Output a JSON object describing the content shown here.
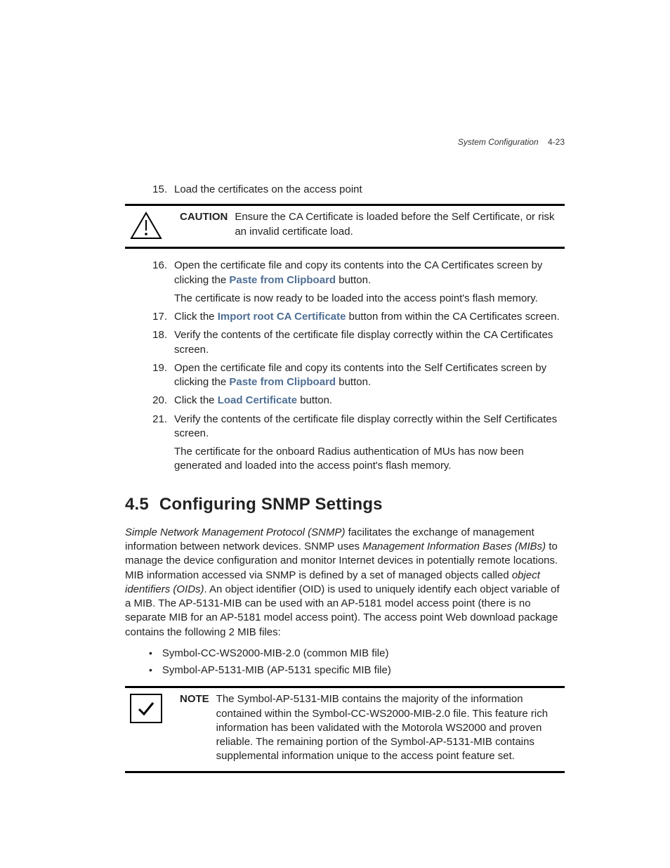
{
  "header": {
    "chapter": "System Configuration",
    "page": "4-23"
  },
  "steps_first": [
    {
      "n": "15.",
      "paras": [
        "Load the certificates on the access point"
      ]
    }
  ],
  "caution": {
    "label": "CAUTION",
    "text": "Ensure the CA Certificate is loaded before the Self Certificate, or risk an invalid certificate load."
  },
  "steps_after": [
    {
      "n": "16.",
      "paras": [
        "Open the certificate file and copy its contents into the CA Certificates screen by clicking the {link:Paste from Clipboard} button.",
        "The certificate is now ready to be loaded into the access point's flash memory."
      ]
    },
    {
      "n": "17.",
      "paras": [
        "Click the {link:Import root CA Certificate} button from within the CA Certificates screen."
      ]
    },
    {
      "n": "18.",
      "paras": [
        "Verify the contents of the certificate file display correctly within the CA Certificates screen."
      ]
    },
    {
      "n": "19.",
      "paras": [
        "Open the certificate file and copy its contents into the Self Certificates screen by clicking the {link:Paste from Clipboard} button."
      ]
    },
    {
      "n": "20.",
      "paras": [
        "Click the {link:Load Certificate} button."
      ]
    },
    {
      "n": "21.",
      "paras": [
        "Verify the contents of the certificate file display correctly within the Self Certificates screen.",
        "The certificate for the onboard Radius authentication of MUs has now been generated and loaded into the access point's flash memory."
      ]
    }
  ],
  "section": {
    "num": "4.5",
    "title": "Configuring SNMP Settings"
  },
  "intro_spans": [
    {
      "t": "Simple Network Management Protocol (SNMP)",
      "i": true
    },
    {
      "t": " facilitates the exchange of management information between network devices. SNMP uses "
    },
    {
      "t": "Management Information Bases (MIBs)",
      "i": true
    },
    {
      "t": " to manage the device configuration and monitor Internet devices in potentially remote locations. MIB information accessed via SNMP is defined by a set of managed objects called "
    },
    {
      "t": "object identifiers (OIDs)",
      "i": true
    },
    {
      "t": ". An object identifier (OID) is used to uniquely identify each object variable of a MIB. The AP-5131-MIB can be used with an AP-5181 model access point (there is no separate MIB for an AP-5181 model access point). The access point Web download package contains the following 2 MIB files:"
    }
  ],
  "bullets": [
    "Symbol-CC-WS2000-MIB-2.0 (common MIB file)",
    "Symbol-AP-5131-MIB (AP-5131 specific MIB file)"
  ],
  "note": {
    "label": "NOTE",
    "text": "The Symbol-AP-5131-MIB contains the majority of the information contained within the Symbol-CC-WS2000-MIB-2.0 file. This feature rich information has been validated with the Motorola WS2000 and proven reliable. The remaining portion of the Symbol-AP-5131-MIB contains supplemental information unique to the access point feature set."
  }
}
